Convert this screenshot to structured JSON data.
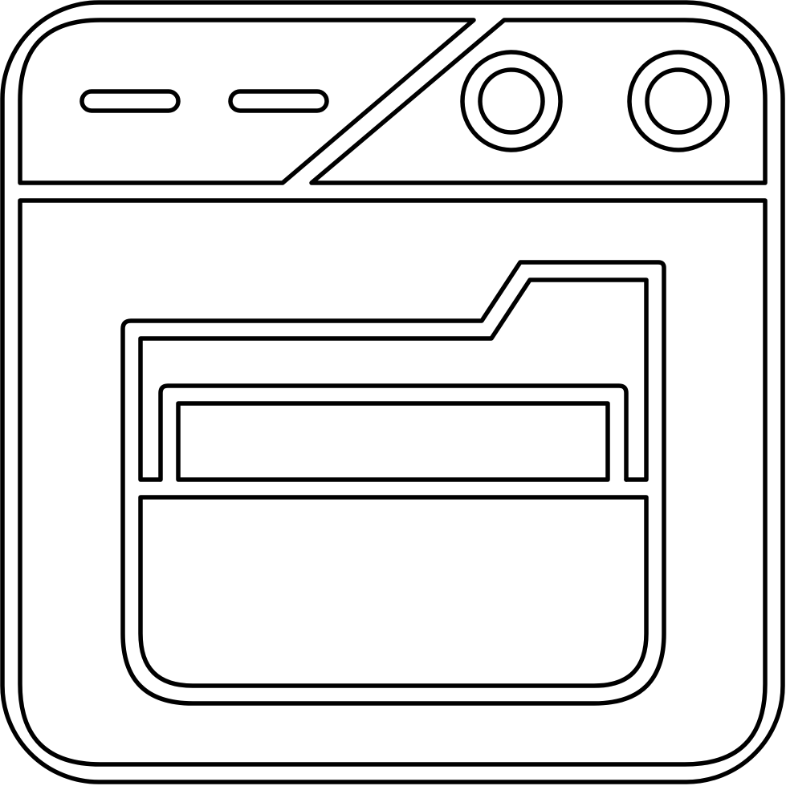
{
  "icon": {
    "name": "browser-window-folder-icon",
    "style": "outline",
    "stroke_color": "#000000",
    "background_color": "#ffffff"
  }
}
